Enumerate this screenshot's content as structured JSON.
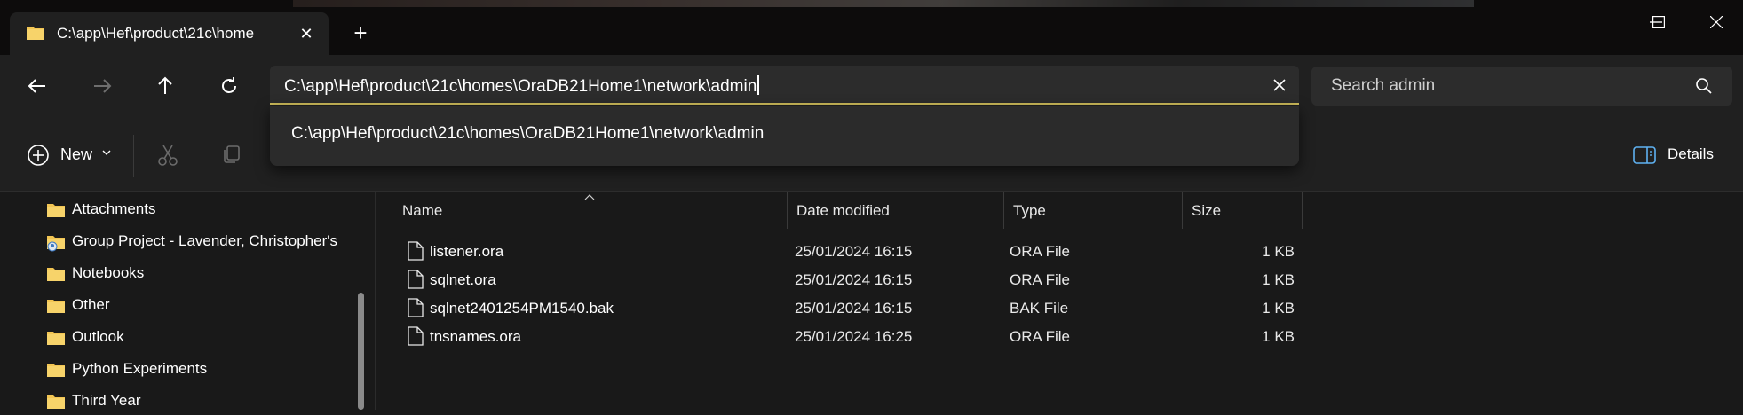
{
  "tab": {
    "title": "C:\\app\\Hef\\product\\21c\\home",
    "close": "✕",
    "new_tab": "+"
  },
  "address": {
    "value": "C:\\app\\Hef\\product\\21c\\homes\\OraDB21Home1\\network\\admin",
    "suggestion": "C:\\app\\Hef\\product\\21c\\homes\\OraDB21Home1\\network\\admin"
  },
  "search": {
    "placeholder": "Search admin"
  },
  "toolbar": {
    "new_label": "New",
    "details_label": "Details"
  },
  "sidebar": {
    "items": [
      {
        "label": "Attachments",
        "icon": "folder-icon"
      },
      {
        "label": "Group Project - Lavender, Christopher's",
        "icon": "shared-folder-icon"
      },
      {
        "label": "Notebooks",
        "icon": "folder-icon"
      },
      {
        "label": "Other",
        "icon": "folder-icon"
      },
      {
        "label": "Outlook",
        "icon": "folder-icon"
      },
      {
        "label": "Python Experiments",
        "icon": "folder-icon"
      },
      {
        "label": "Third Year",
        "icon": "folder-icon"
      }
    ]
  },
  "columns": {
    "name": "Name",
    "date": "Date modified",
    "type": "Type",
    "size": "Size"
  },
  "files": [
    {
      "name": "listener.ora",
      "date": "25/01/2024 16:15",
      "type": "ORA File",
      "size": "1 KB"
    },
    {
      "name": "sqlnet.ora",
      "date": "25/01/2024 16:15",
      "type": "ORA File",
      "size": "1 KB"
    },
    {
      "name": "sqlnet2401254PM1540.bak",
      "date": "25/01/2024 16:15",
      "type": "BAK File",
      "size": "1 KB"
    },
    {
      "name": "tnsnames.ora",
      "date": "25/01/2024 16:25",
      "type": "ORA File",
      "size": "1 KB"
    }
  ],
  "colors": {
    "accent_underline": "#cdbb5a",
    "folder": "#f2c553",
    "background": "#191919"
  }
}
